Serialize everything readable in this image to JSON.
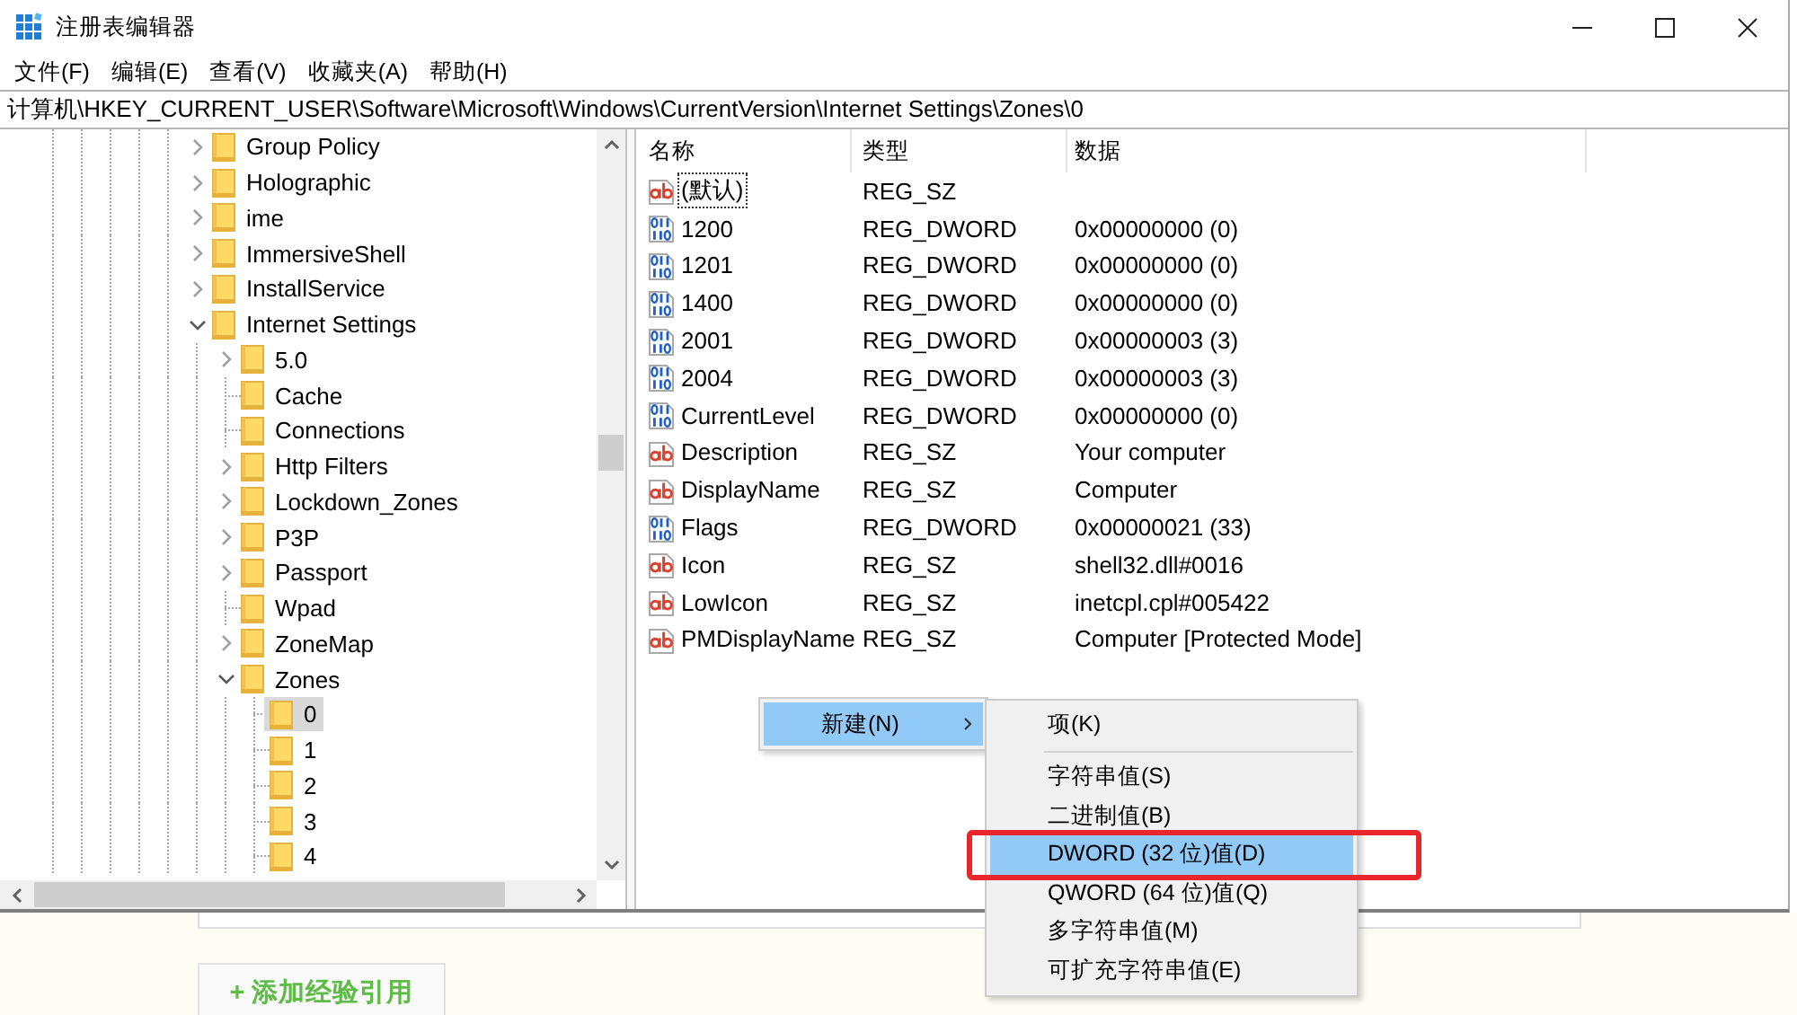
{
  "window": {
    "title": "注册表编辑器"
  },
  "menu": [
    "文件(F)",
    "编辑(E)",
    "查看(V)",
    "收藏夹(A)",
    "帮助(H)"
  ],
  "address": "计算机\\HKEY_CURRENT_USER\\Software\\Microsoft\\Windows\\CurrentVersion\\Internet Settings\\Zones\\0",
  "tree": {
    "items": [
      {
        "kind": "branch",
        "label": "Group Policy",
        "expanded": false,
        "selected": false
      },
      {
        "kind": "branch",
        "label": "Holographic",
        "expanded": false,
        "selected": false
      },
      {
        "kind": "branch",
        "label": "ime",
        "expanded": false,
        "selected": false
      },
      {
        "kind": "branch",
        "label": "ImmersiveShell",
        "expanded": false,
        "selected": false
      },
      {
        "kind": "branch",
        "label": "InstallService",
        "expanded": false,
        "selected": false
      },
      {
        "kind": "branch",
        "label": "Internet Settings",
        "expanded": true,
        "selected": false,
        "children": [
          {
            "kind": "branch",
            "label": "5.0",
            "expanded": false,
            "selected": false
          },
          {
            "kind": "leaf",
            "label": "Cache",
            "selected": false
          },
          {
            "kind": "leaf",
            "label": "Connections",
            "selected": false
          },
          {
            "kind": "branch",
            "label": "Http Filters",
            "expanded": false,
            "selected": false
          },
          {
            "kind": "branch",
            "label": "Lockdown_Zones",
            "expanded": false,
            "selected": false
          },
          {
            "kind": "branch",
            "label": "P3P",
            "expanded": false,
            "selected": false
          },
          {
            "kind": "branch",
            "label": "Passport",
            "expanded": false,
            "selected": false
          },
          {
            "kind": "leaf",
            "label": "Wpad",
            "selected": false
          },
          {
            "kind": "branch",
            "label": "ZoneMap",
            "expanded": false,
            "selected": false
          },
          {
            "kind": "branch",
            "label": "Zones",
            "expanded": true,
            "selected": false,
            "children": [
              {
                "kind": "leaf",
                "label": "0",
                "selected": true
              },
              {
                "kind": "leaf",
                "label": "1",
                "selected": false
              },
              {
                "kind": "leaf",
                "label": "2",
                "selected": false
              },
              {
                "kind": "leaf",
                "label": "3",
                "selected": false
              },
              {
                "kind": "leaf",
                "label": "4",
                "selected": false
              }
            ]
          }
        ]
      }
    ]
  },
  "values": {
    "columns": [
      "名称",
      "类型",
      "数据"
    ],
    "rows": [
      {
        "kind": "string",
        "name": "(默认)",
        "type": "REG_SZ",
        "focused": true
      },
      {
        "kind": "dword",
        "name": "1200",
        "type": "REG_DWORD",
        "data": "0x00000000 (0)",
        "focused": false
      },
      {
        "kind": "dword",
        "name": "1201",
        "type": "REG_DWORD",
        "data": "0x00000000 (0)",
        "focused": false
      },
      {
        "kind": "dword",
        "name": "1400",
        "type": "REG_DWORD",
        "data": "0x00000000 (0)",
        "focused": false
      },
      {
        "kind": "dword",
        "name": "2001",
        "type": "REG_DWORD",
        "data": "0x00000003 (3)",
        "focused": false
      },
      {
        "kind": "dword",
        "name": "2004",
        "type": "REG_DWORD",
        "data": "0x00000003 (3)",
        "focused": false
      },
      {
        "kind": "dword",
        "name": "CurrentLevel",
        "type": "REG_DWORD",
        "data": "0x00000000 (0)",
        "focused": false
      },
      {
        "kind": "string",
        "name": "Description",
        "type": "REG_SZ",
        "data": "Your computer",
        "focused": false
      },
      {
        "kind": "string",
        "name": "DisplayName",
        "type": "REG_SZ",
        "data": "Computer",
        "focused": false
      },
      {
        "kind": "dword",
        "name": "Flags",
        "type": "REG_DWORD",
        "data": "0x00000021 (33)",
        "focused": false
      },
      {
        "kind": "string",
        "name": "Icon",
        "type": "REG_SZ",
        "data": "shell32.dll#0016",
        "focused": false
      },
      {
        "kind": "string",
        "name": "LowIcon",
        "type": "REG_SZ",
        "data": "inetcpl.cpl#005422",
        "focused": false
      },
      {
        "kind": "string",
        "name": "PMDisplayName",
        "type": "REG_SZ",
        "data": "Computer [Protected Mode]",
        "focused": false
      }
    ]
  },
  "context_menu": {
    "items": [
      {
        "label": "新建(N)",
        "selected": true,
        "has_submenu": true
      }
    ]
  },
  "submenu": {
    "items": [
      {
        "kind": "item",
        "label": "项(K)",
        "selected": false,
        "annotated": false
      },
      {
        "kind": "separator"
      },
      {
        "kind": "item",
        "label": "字符串值(S)",
        "selected": false,
        "annotated": false
      },
      {
        "kind": "item",
        "label": "二进制值(B)",
        "selected": false,
        "annotated": false
      },
      {
        "kind": "item",
        "label": "DWORD (32 位)值(D)",
        "selected": true,
        "annotated": true
      },
      {
        "kind": "item",
        "label": "QWORD (64 位)值(Q)",
        "selected": false,
        "annotated": false
      },
      {
        "kind": "item",
        "label": "多字符串值(M)",
        "selected": false,
        "annotated": false
      },
      {
        "kind": "item",
        "label": "可扩充字符串值(E)",
        "selected": false,
        "annotated": false
      }
    ]
  },
  "page": {
    "add_button": "+ 添加经验引用"
  }
}
